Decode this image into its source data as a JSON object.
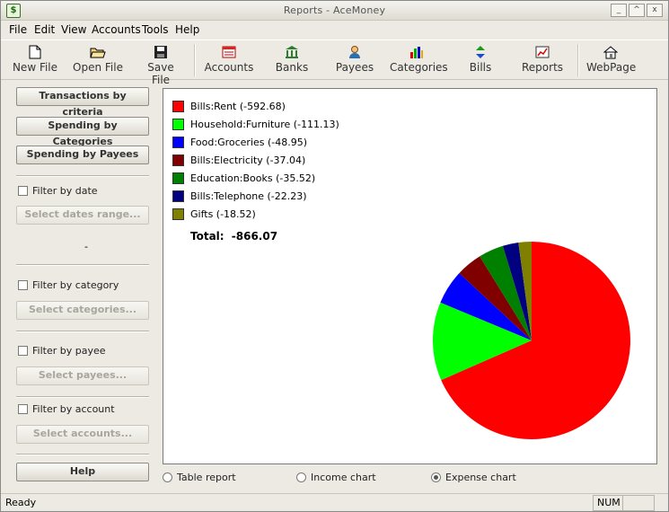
{
  "window": {
    "title": "Reports - AceMoney",
    "icon": "acemoney-logo-icon"
  },
  "menu": [
    "File",
    "Edit",
    "View",
    "Accounts",
    "Tools",
    "Help"
  ],
  "toolbar": [
    {
      "label": "New File",
      "icon": "new-file-icon"
    },
    {
      "label": "Open File",
      "icon": "open-folder-icon"
    },
    {
      "label": "Save File",
      "icon": "floppy-disk-icon"
    },
    {
      "label": "Accounts",
      "icon": "accounts-icon"
    },
    {
      "label": "Banks",
      "icon": "bank-icon"
    },
    {
      "label": "Payees",
      "icon": "person-icon"
    },
    {
      "label": "Categories",
      "icon": "bar-chart-icon"
    },
    {
      "label": "Bills",
      "icon": "bills-icon"
    },
    {
      "label": "Reports",
      "icon": "reports-icon"
    },
    {
      "label": "WebPage",
      "icon": "home-icon"
    }
  ],
  "sidebar": {
    "transactions_by_criteria": "Transactions by criteria",
    "spending_by_categories": "Spending by Categories",
    "spending_by_payees": "Spending by Payees",
    "filter_date": "Filter by date",
    "select_dates": "Select dates range...",
    "dates_value": "-",
    "filter_category": "Filter by category",
    "select_categories": "Select categories...",
    "filter_payee": "Filter by payee",
    "select_payees": "Select payees...",
    "filter_account": "Filter by account",
    "select_accounts": "Select accounts...",
    "help": "Help"
  },
  "chart_data": {
    "type": "pie",
    "slices": [
      {
        "label": "Bills:Rent (-592.68)",
        "value": 592.68,
        "color": "#ff0000"
      },
      {
        "label": "Household:Furniture (-111.13)",
        "value": 111.13,
        "color": "#00ff00"
      },
      {
        "label": "Food:Groceries (-48.95)",
        "value": 48.95,
        "color": "#0000ff"
      },
      {
        "label": "Bills:Electricity (-37.04)",
        "value": 37.04,
        "color": "#800000"
      },
      {
        "label": "Education:Books (-35.52)",
        "value": 35.52,
        "color": "#008000"
      },
      {
        "label": "Bills:Telephone (-22.23)",
        "value": 22.23,
        "color": "#000080"
      },
      {
        "label": "Gifts (-18.52)",
        "value": 18.52,
        "color": "#808000"
      }
    ],
    "total_label": "Total:",
    "total_value": "-866.07"
  },
  "report_type": {
    "table": "Table report",
    "income": "Income chart",
    "expense": "Expense chart",
    "selected": "expense"
  },
  "status": {
    "text": "Ready",
    "num": "NUM"
  }
}
